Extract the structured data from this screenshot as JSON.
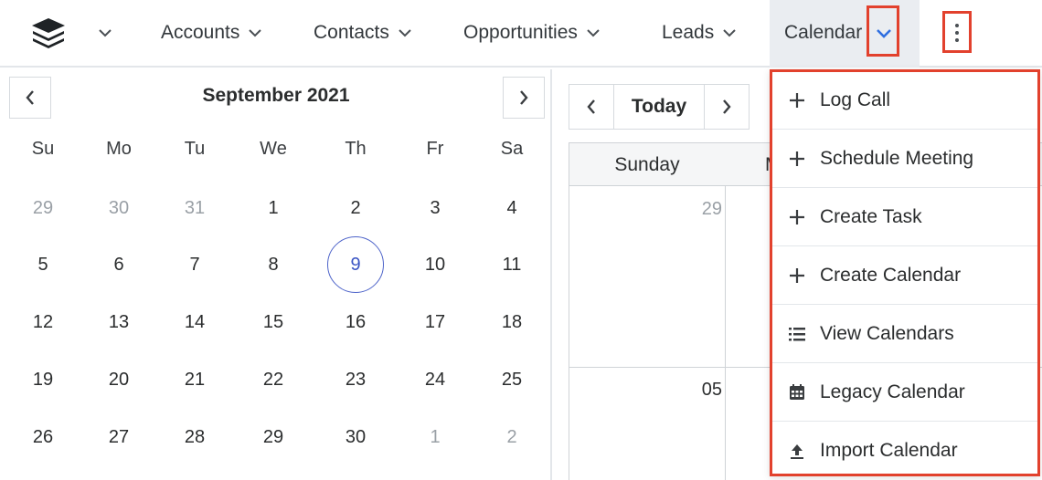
{
  "nav": {
    "items": [
      {
        "label": "Accounts"
      },
      {
        "label": "Contacts"
      },
      {
        "label": "Opportunities"
      },
      {
        "label": "Leads"
      },
      {
        "label": "Calendar"
      }
    ]
  },
  "mini_calendar": {
    "month_title": "September 2021",
    "weekdays": [
      "Su",
      "Mo",
      "Tu",
      "We",
      "Th",
      "Fr",
      "Sa"
    ],
    "weeks": [
      [
        "29",
        "30",
        "31",
        "1",
        "2",
        "3",
        "4"
      ],
      [
        "5",
        "6",
        "7",
        "8",
        "9",
        "10",
        "11"
      ],
      [
        "12",
        "13",
        "14",
        "15",
        "16",
        "17",
        "18"
      ],
      [
        "19",
        "20",
        "21",
        "22",
        "23",
        "24",
        "25"
      ],
      [
        "26",
        "27",
        "28",
        "29",
        "30",
        "1",
        "2"
      ]
    ],
    "selected_day": "9"
  },
  "main_calendar": {
    "today_label": "Today",
    "column_header": "Sunday",
    "partial_next_header": "M",
    "cells": [
      "29",
      "05"
    ]
  },
  "dropdown": {
    "items": [
      {
        "label": "Log Call",
        "icon": "plus-icon"
      },
      {
        "label": "Schedule Meeting",
        "icon": "plus-icon"
      },
      {
        "label": "Create Task",
        "icon": "plus-icon"
      },
      {
        "label": "Create Calendar",
        "icon": "plus-icon"
      },
      {
        "label": "View Calendars",
        "icon": "list-icon"
      },
      {
        "label": "Legacy Calendar",
        "icon": "calendar-icon"
      },
      {
        "label": "Import Calendar",
        "icon": "upload-icon"
      }
    ]
  },
  "colors": {
    "highlight": "#e2412d",
    "today_ring": "#4d63c9",
    "chevron_active": "#2f6fe0"
  }
}
